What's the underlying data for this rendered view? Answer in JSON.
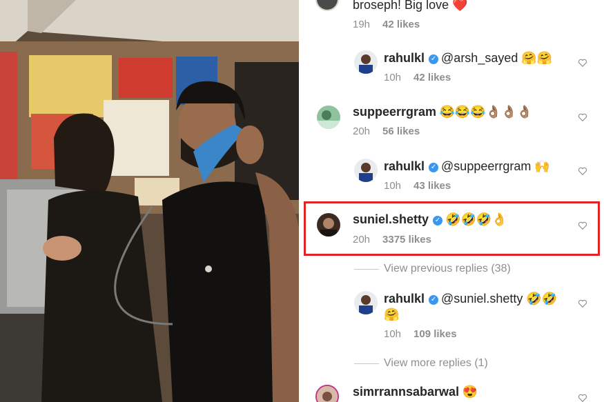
{
  "comments": [
    {
      "user": "",
      "text": "broseph! Big love ❤️",
      "time": "19h",
      "likes": "42 likes"
    },
    {
      "user": "rahulkl",
      "text": "@arsh_sayed 🤗🤗",
      "time": "10h",
      "likes": "42 likes"
    },
    {
      "user": "suppeerrgram",
      "text": "😂😂😂👌🏽👌🏽👌🏽",
      "time": "20h",
      "likes": "56 likes"
    },
    {
      "user": "rahulkl",
      "text": "@suppeerrgram 🙌",
      "time": "10h",
      "likes": "43 likes"
    },
    {
      "user": "suniel.shetty",
      "text": "🤣🤣🤣👌",
      "time": "20h",
      "likes": "3375 likes"
    },
    {
      "user": "rahulkl",
      "text": "@suniel.shetty 🤣🤣",
      "text2": "🤗",
      "time": "10h",
      "likes": "109 likes"
    },
    {
      "user": "simrrannsabarwal",
      "text": "😍"
    }
  ],
  "view_previous": "View previous replies (38)",
  "view_more": "View more replies (1)",
  "colors": {
    "highlight": "#e02424",
    "verified": "#3897f0",
    "meta": "#8e8e8e"
  }
}
